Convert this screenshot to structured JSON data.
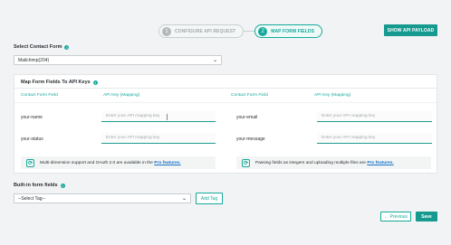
{
  "steps": [
    {
      "number": "1",
      "label": "CONFIGURE API REQUEST"
    },
    {
      "number": "2",
      "label": "MAP FORM FIELDS"
    }
  ],
  "header": {
    "show_payload_label": "SHOW API PAYLOAD"
  },
  "contact_form": {
    "label": "Select Contact Form",
    "selected": "Mailchimp(204)"
  },
  "mapping": {
    "title": "Map Form Fields To API Keys",
    "columns": {
      "left_field": "Contact Form Field",
      "left_key": "API Key (Mapping)",
      "right_field": "Contact Form Field",
      "right_key": "API Key (Mapping)"
    },
    "placeholder": "Enter your API mapping key",
    "rows": [
      {
        "left": "your-name",
        "right": "your-email"
      },
      {
        "left": "your-status",
        "right": "your-message"
      }
    ],
    "notice_left": {
      "text": "Multi-dimension support and OAuth 2.0 are available in the",
      "link": "Pro features."
    },
    "notice_right": {
      "text": "Passing fields as integers and uploading multiple files are",
      "link": "Pro features."
    }
  },
  "builtin": {
    "label": "Built-in form fields",
    "selected": "--Select Tag--",
    "add_tag_label": "Add Tag"
  },
  "footer": {
    "previous_label": "← Previous",
    "save_label": "Save"
  },
  "colors": {
    "accent": "#169a90",
    "link": "#1a73c9"
  },
  "icons": {
    "info": "info-icon",
    "chevron": "chevron-down-icon",
    "pro": "pro-feature-icon"
  }
}
